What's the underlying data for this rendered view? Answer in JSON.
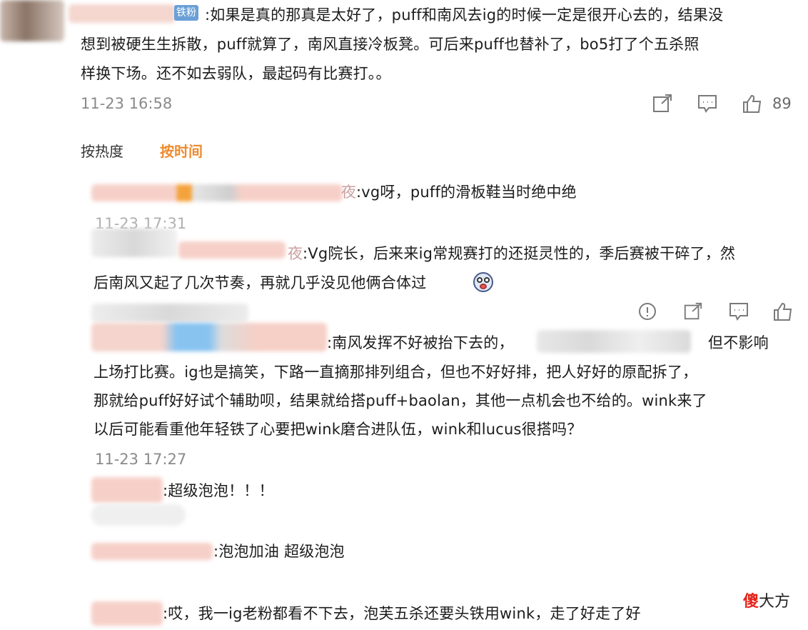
{
  "top_comment": {
    "badge": "铁粉",
    "lines": [
      ":如果是真的那真是太好了，puff和南风去ig的时候一定是很开心去的，结果没",
      "想到被硬生生拆散，puff就算了，南风直接冷板凳。可后来puff也替补了，bo5打了个五杀照",
      "样换下场。还不如去弱队，最起码有比赛打。。"
    ],
    "time": "11-23 16:58",
    "like_count": "89"
  },
  "sort_tabs": [
    "按热度",
    "按时间"
  ],
  "replies": [
    {
      "name_tail": "夜",
      "text": ":vg呀，puff的滑板鞋当时绝中绝"
    },
    {
      "time": "11-23 17:31"
    },
    {
      "name_tail": "夜",
      "lines": [
        ":Vg院长，后来来ig常规赛打的还挺灵性的，季后赛被干碎了，然",
        "后南风又起了几次节奏，再就几乎没见他俩合体过"
      ]
    },
    {
      "lines": [
        ":南风发挥不好被抬下去的，",
        "上场打比赛。ig也是搞笑，下路一直摘那排列组合，但也不好好排，把人好好的原配拆了，",
        "那就给puff好好试个辅助呗，结果就给搭puff+baolan，其他一点机会也不给的。wink来了",
        "以后可能看重他年轻铁了心要把wink磨合进队伍，wink和lucus很搭吗？"
      ],
      "line1_tail": "但不影响",
      "time": "11-23 17:27"
    },
    {
      "text": ":超级泡泡！！！"
    },
    {
      "text": ":泡泡加油 超级泡泡"
    },
    {
      "text": ":哎，我一ig老粉都看不下去，泡芙五杀还要头铁用wink，走了好走了好"
    }
  ],
  "watermark": {
    "red": "傻",
    "black": "大方"
  },
  "icons": [
    "share-icon",
    "comment-icon",
    "like-icon"
  ],
  "colors": {
    "accent": "#f08a2e",
    "text": "#1c1c1c",
    "time": "#8a8a8a",
    "badge": "#6aa0d6"
  }
}
